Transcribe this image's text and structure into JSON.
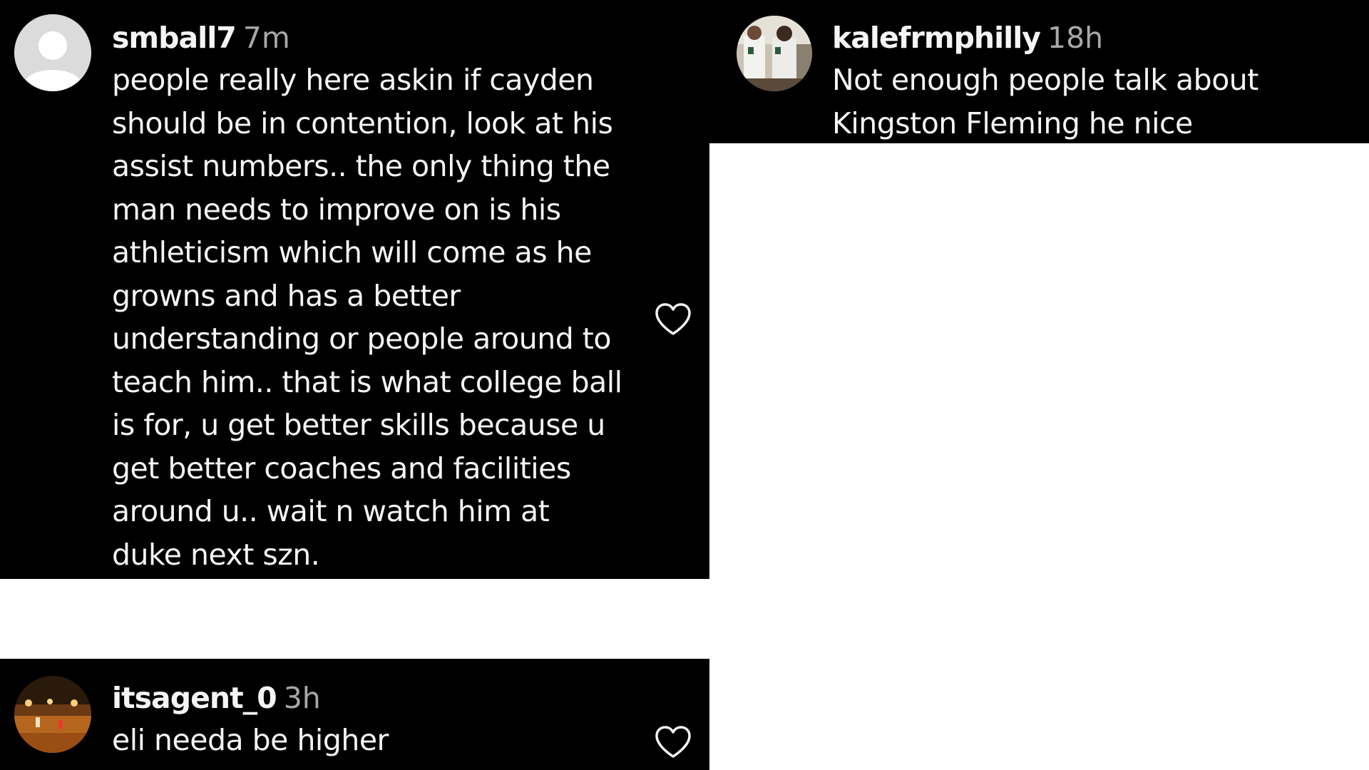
{
  "comments": [
    {
      "username": "smball7",
      "time": "7m",
      "avatar": "default-avatar-icon",
      "lines": [
        "people really here askin if cayden",
        "should be in contention, look at his",
        "assist numbers.. the only thing the",
        "man needs to improve on is his",
        "athleticism which will come as he",
        "growns and has a better",
        "understanding or people around to",
        "teach him.. that is what college ball",
        "is for, u get better skills because u",
        "get better coaches and facilities",
        "around u.. wait n watch him at",
        "duke next szn."
      ],
      "like_icon": "heart-icon"
    },
    {
      "username": "kalefrmphilly",
      "time": "18h",
      "avatar": "team-photo-avatar",
      "lines": [
        "Not enough people talk about",
        "Kingston Fleming he nice"
      ]
    },
    {
      "username": "itsagent_0",
      "time": "3h",
      "avatar": "court-photo-avatar",
      "lines": [
        "eli needa be higher"
      ],
      "like_icon": "heart-icon"
    }
  ],
  "colors": {
    "card_background": "#000000",
    "page_background": "#ffffff",
    "text_primary": "#f5f5f5",
    "text_secondary": "#a8a8a8"
  }
}
